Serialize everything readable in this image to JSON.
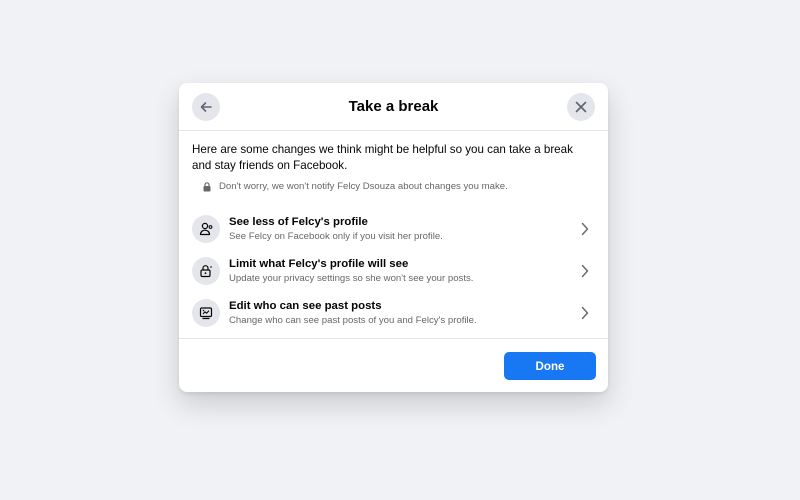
{
  "dialog": {
    "title": "Take a break",
    "intro": "Here are some changes we think might be helpful so you can take a break and stay friends on Facebook.",
    "notice": "Don't worry, we won't notify Felcy Dsouza about changes you make.",
    "options": [
      {
        "icon": "person-icon",
        "title": "See less of Felcy's profile",
        "subtitle": "See Felcy on Facebook only if you visit her profile."
      },
      {
        "icon": "lock-icon",
        "title": "Limit what Felcy's profile will see",
        "subtitle": "Update your privacy settings so she won't see your posts."
      },
      {
        "icon": "posts-icon",
        "title": "Edit who can see past posts",
        "subtitle": "Change who can see past posts of you and Felcy's profile."
      }
    ],
    "done_label": "Done"
  },
  "colors": {
    "background": "#f0f2f5",
    "accent": "#1877f2",
    "secondary_text": "#65676b",
    "icon_bg": "#e4e6eb"
  }
}
